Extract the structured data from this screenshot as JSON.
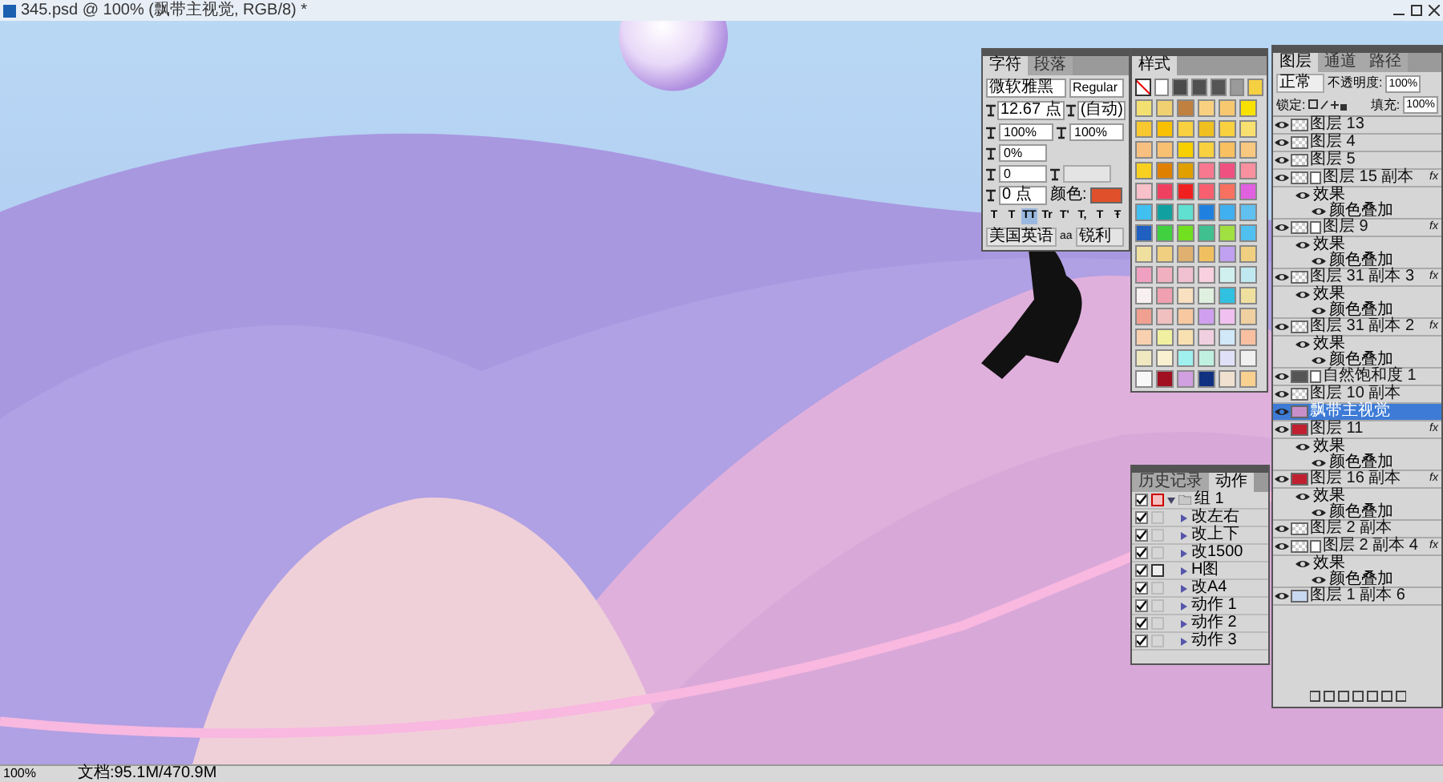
{
  "window": {
    "title": "345.psd @ 100% (飘带主视觉, RGB/8) *"
  },
  "character_panel": {
    "tabs": [
      {
        "label": "字符",
        "selected": true
      },
      {
        "label": "段落",
        "selected": false
      }
    ],
    "font_family": "微软雅黑",
    "font_style": "Regular",
    "size": "12.67 点",
    "leading": "(自动)",
    "vertical_scale": "100%",
    "horizontal_scale": "100%",
    "tracking": "0%",
    "kerning": "0",
    "baseline_shift": "0 点",
    "color_label": "颜色:",
    "color": "#e0502a",
    "style_buttons": [
      {
        "label": "T",
        "selected": false
      },
      {
        "label": "T",
        "selected": false
      },
      {
        "label": "TT",
        "selected": true
      },
      {
        "label": "Tr",
        "selected": false
      },
      {
        "label": "T'",
        "selected": false
      },
      {
        "label": "T,",
        "selected": false
      },
      {
        "label": "T",
        "selected": false
      },
      {
        "label": "Ŧ",
        "selected": false
      }
    ],
    "language": "美国英语",
    "antialias_label": "aa",
    "antialias": "锐利"
  },
  "styles_panel": {
    "tabs": [
      {
        "label": "样式",
        "selected": true
      }
    ],
    "rows": [
      {
        "swatches": [
          {
            "color": "#ffffff"
          },
          {
            "color": "#4a4a4a"
          },
          {
            "color": "#505050"
          },
          {
            "color": "#555555"
          },
          {
            "color": "#9a9a9a"
          },
          {
            "color": "#f5d040"
          }
        ]
      },
      {
        "swatches": [
          {
            "color": "#f3e070"
          },
          {
            "color": "#f0d070"
          },
          {
            "color": "#c08040"
          },
          {
            "color": "#f8d080"
          },
          {
            "color": "#f8c870"
          },
          {
            "color": "#f8e000"
          }
        ]
      },
      {
        "swatches": [
          {
            "color": "#f8c830"
          },
          {
            "color": "#f8c000"
          },
          {
            "color": "#f8d040"
          },
          {
            "color": "#f0c020"
          },
          {
            "color": "#f8d040"
          },
          {
            "color": "#f8e070"
          }
        ]
      },
      {
        "swatches": [
          {
            "color": "#f8c080"
          },
          {
            "color": "#f8c070"
          },
          {
            "color": "#f8d000"
          },
          {
            "color": "#f8d040"
          },
          {
            "color": "#f8c060"
          },
          {
            "color": "#f8c880"
          }
        ]
      },
      {
        "swatches": [
          {
            "color": "#f8d020"
          },
          {
            "color": "#e08000"
          },
          {
            "color": "#e0a000"
          },
          {
            "color": "#f87890"
          },
          {
            "color": "#f05080"
          },
          {
            "color": "#f890a0"
          }
        ]
      },
      {
        "swatches": [
          {
            "color": "#f8c0c8"
          },
          {
            "color": "#f04060"
          },
          {
            "color": "#f02020"
          },
          {
            "color": "#f86070"
          },
          {
            "color": "#f87060"
          },
          {
            "color": "#e060e0"
          }
        ]
      },
      {
        "swatches": [
          {
            "color": "#40c0f0"
          },
          {
            "color": "#10a0a0"
          },
          {
            "color": "#60e0d0"
          },
          {
            "color": "#2080e0"
          },
          {
            "color": "#40b0f0"
          },
          {
            "color": "#60c0f0"
          }
        ]
      },
      {
        "swatches": [
          {
            "color": "#2060c0"
          },
          {
            "color": "#40d040"
          },
          {
            "color": "#70e020"
          },
          {
            "color": "#40c090"
          },
          {
            "color": "#a0e040"
          },
          {
            "color": "#50c0f0"
          }
        ]
      },
      {
        "swatches": [
          {
            "color": "#f0e0a0"
          },
          {
            "color": "#f0d080"
          },
          {
            "color": "#e0b070"
          },
          {
            "color": "#f0c060"
          },
          {
            "color": "#c0a0f0"
          },
          {
            "color": "#f0d080"
          }
        ]
      },
      {
        "swatches": [
          {
            "color": "#f0a0c0"
          },
          {
            "color": "#f0b0c0"
          },
          {
            "color": "#f0c0d0"
          },
          {
            "color": "#f8d0e0"
          },
          {
            "color": "#d0f0f0"
          },
          {
            "color": "#c0e8f0"
          }
        ]
      },
      {
        "swatches": [
          {
            "color": "#f8f0f0"
          },
          {
            "color": "#f0a0b0"
          },
          {
            "color": "#f8e0c0"
          },
          {
            "color": "#e0f0e0"
          },
          {
            "color": "#30c0e0"
          },
          {
            "color": "#f0e0a0"
          }
        ]
      },
      {
        "swatches": [
          {
            "color": "#f0a090"
          },
          {
            "color": "#f0c0c0"
          },
          {
            "color": "#f8c8a0"
          },
          {
            "color": "#d0a0f0"
          },
          {
            "color": "#f0c0f0"
          },
          {
            "color": "#f0d0a0"
          }
        ]
      },
      {
        "swatches": [
          {
            "color": "#f8d0b0"
          },
          {
            "color": "#f0f0a0"
          },
          {
            "color": "#f8e0b0"
          },
          {
            "color": "#f0d0e0"
          },
          {
            "color": "#d0e8f8"
          },
          {
            "color": "#f8c0a0"
          }
        ]
      },
      {
        "swatches": [
          {
            "color": "#f0e8c0"
          },
          {
            "color": "#f8f0d0"
          },
          {
            "color": "#a0f0f0"
          },
          {
            "color": "#c0f0e0"
          },
          {
            "color": "#e0e0f8"
          },
          {
            "color": "#f0f0f0"
          }
        ]
      },
      {
        "swatches": [
          {
            "color": "#f8f8f8"
          },
          {
            "color": "#a01020"
          },
          {
            "color": "#d0a0e0"
          },
          {
            "color": "#103080"
          },
          {
            "color": "#f0e0d0"
          },
          {
            "color": "#f8d090"
          }
        ]
      }
    ]
  },
  "actions_panel": {
    "tabs": [
      {
        "label": "历史记录",
        "selected": false
      },
      {
        "label": "动作",
        "selected": true
      }
    ],
    "set": {
      "name": "组 1",
      "checked": true,
      "dialog": true,
      "expanded": true,
      "children": [
        {
          "name": "改左右",
          "checked": true,
          "dialog": false
        },
        {
          "name": "改上下",
          "checked": true,
          "dialog": false
        },
        {
          "name": "改1500",
          "checked": true,
          "dialog": false
        },
        {
          "name": "H图",
          "checked": true,
          "dialog": true
        },
        {
          "name": "改A4",
          "checked": true,
          "dialog": false
        },
        {
          "name": "动作 1",
          "checked": true,
          "dialog": false
        },
        {
          "name": "动作 2",
          "checked": true,
          "dialog": false
        },
        {
          "name": "动作 3",
          "checked": true,
          "dialog": false
        }
      ]
    }
  },
  "layers_panel": {
    "tabs": [
      {
        "label": "图层",
        "selected": true
      },
      {
        "label": "通道",
        "selected": false
      },
      {
        "label": "路径",
        "selected": false
      }
    ],
    "blend_mode": "正常",
    "opacity_label": "不透明度:",
    "opacity": "100%",
    "lock_label": "锁定:",
    "fill_label": "填充:",
    "fill": "100%",
    "layers": [
      {
        "name": "图层 13",
        "kind": "pixel",
        "mask": false,
        "selected": false,
        "visible": true
      },
      {
        "name": "图层 4",
        "kind": "pixel",
        "mask": false,
        "selected": false,
        "visible": true
      },
      {
        "name": "图层 5",
        "kind": "pixel",
        "mask": false,
        "selected": false,
        "visible": true
      },
      {
        "name": "图层 15 副本",
        "kind": "pixel",
        "mask": true,
        "selected": false,
        "visible": true,
        "fx": "fx",
        "children": [
          {
            "name": "效果",
            "children": [
              {
                "name": "颜色叠加"
              }
            ]
          }
        ]
      },
      {
        "name": "图层 9",
        "kind": "pixel",
        "mask": true,
        "selected": false,
        "visible": true,
        "fx": "fx",
        "children": [
          {
            "name": "效果",
            "children": [
              {
                "name": "颜色叠加"
              }
            ]
          }
        ]
      },
      {
        "name": "图层 31 副本 3",
        "kind": "pixel",
        "mask": false,
        "selected": false,
        "visible": true,
        "fx": "fx",
        "children": [
          {
            "name": "效果",
            "children": [
              {
                "name": "颜色叠加"
              }
            ]
          }
        ]
      },
      {
        "name": "图层 31 副本 2",
        "kind": "pixel",
        "mask": false,
        "selected": false,
        "visible": true,
        "fx": "fx",
        "children": [
          {
            "name": "效果",
            "children": [
              {
                "name": "颜色叠加"
              }
            ]
          }
        ]
      },
      {
        "name": "自然饱和度 1",
        "kind": "adjustment",
        "mask": true,
        "selected": false,
        "visible": true
      },
      {
        "name": "图层 10 副本",
        "kind": "pixel",
        "mask": false,
        "selected": false,
        "visible": true
      },
      {
        "name": "飘带主视觉",
        "kind": "image",
        "mask": false,
        "selected": true,
        "visible": true
      },
      {
        "name": "图层 11",
        "kind": "red",
        "mask": false,
        "selected": false,
        "visible": true,
        "fx": "fx",
        "children": [
          {
            "name": "效果",
            "children": [
              {
                "name": "颜色叠加"
              }
            ]
          }
        ]
      },
      {
        "name": "图层 16 副本",
        "kind": "red",
        "mask": false,
        "selected": false,
        "visible": true,
        "fx": "fx",
        "children": [
          {
            "name": "效果",
            "children": [
              {
                "name": "颜色叠加"
              }
            ]
          }
        ]
      },
      {
        "name": "图层 2 副本",
        "kind": "pixel",
        "mask": false,
        "selected": false,
        "visible": true
      },
      {
        "name": "图层 2 副本 4",
        "kind": "pixel",
        "mask": true,
        "selected": false,
        "visible": true,
        "fx": "fx",
        "children": [
          {
            "name": "效果",
            "children": [
              {
                "name": "颜色叠加"
              }
            ]
          }
        ]
      },
      {
        "name": "图层 1 副本 6",
        "kind": "light",
        "mask": false,
        "selected": false,
        "visible": true
      }
    ]
  },
  "status_bar": {
    "zoom": "100%",
    "document": "文档:95.1M/470.9M"
  }
}
